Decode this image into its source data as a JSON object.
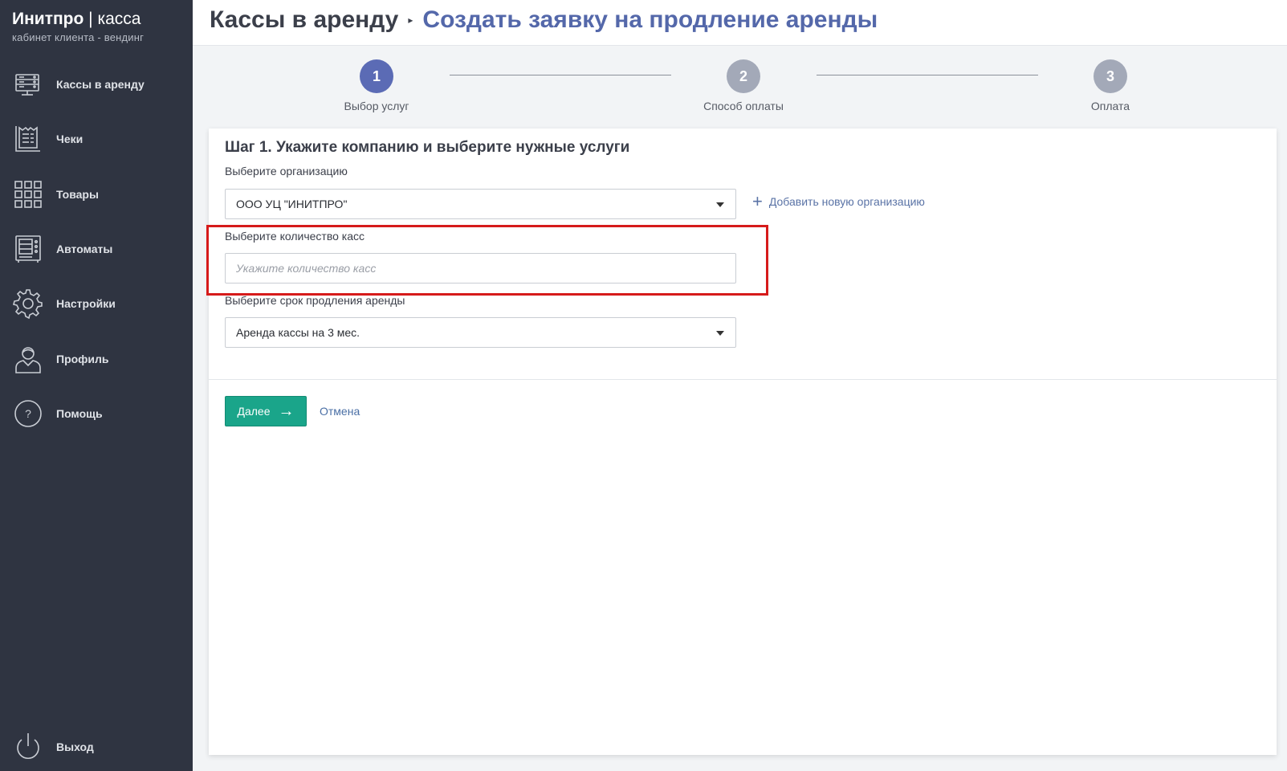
{
  "brand": {
    "name_bold": "Инитпро",
    "separator": "|",
    "name_light": "касса",
    "subtitle": "кабинет клиента - вендинг"
  },
  "sidebar": {
    "items": [
      {
        "label": "Кассы в аренду",
        "icon": "cash-register-icon"
      },
      {
        "label": "Чеки",
        "icon": "receipt-icon"
      },
      {
        "label": "Товары",
        "icon": "grid-icon"
      },
      {
        "label": "Автоматы",
        "icon": "vending-machine-icon"
      },
      {
        "label": "Настройки",
        "icon": "gear-icon"
      },
      {
        "label": "Профиль",
        "icon": "user-icon"
      },
      {
        "label": "Помощь",
        "icon": "help-icon"
      }
    ],
    "logout": {
      "label": "Выход",
      "icon": "power-icon"
    }
  },
  "header": {
    "breadcrumb_root": "Кассы в аренду",
    "breadcrumb_current": "Создать заявку на продление аренды"
  },
  "stepper": {
    "steps": [
      {
        "number": "1",
        "label": "Выбор услуг",
        "active": true
      },
      {
        "number": "2",
        "label": "Способ оплаты",
        "active": false
      },
      {
        "number": "3",
        "label": "Оплата",
        "active": false
      }
    ]
  },
  "form": {
    "title": "Шаг 1. Укажите компанию и выберите нужные услуги",
    "org_label": "Выберите организацию",
    "org_value": "ООО УЦ \"ИНИТПРО\"",
    "add_org_label": "Добавить новую организацию",
    "count_label": "Выберите количество касс",
    "count_placeholder": "Укажите количество касс",
    "count_value": "",
    "term_label": "Выберите срок продления аренды",
    "term_value": "Аренда кассы на 3 мес.",
    "next_label": "Далее",
    "cancel_label": "Отмена"
  },
  "colors": {
    "sidebar_bg": "#2f3441",
    "active_step": "#5b6bb5",
    "inactive_step": "#a3a9b8",
    "primary_button": "#1aa58a",
    "highlight_border": "#d61b1b",
    "breadcrumb_current": "#5468aa"
  }
}
